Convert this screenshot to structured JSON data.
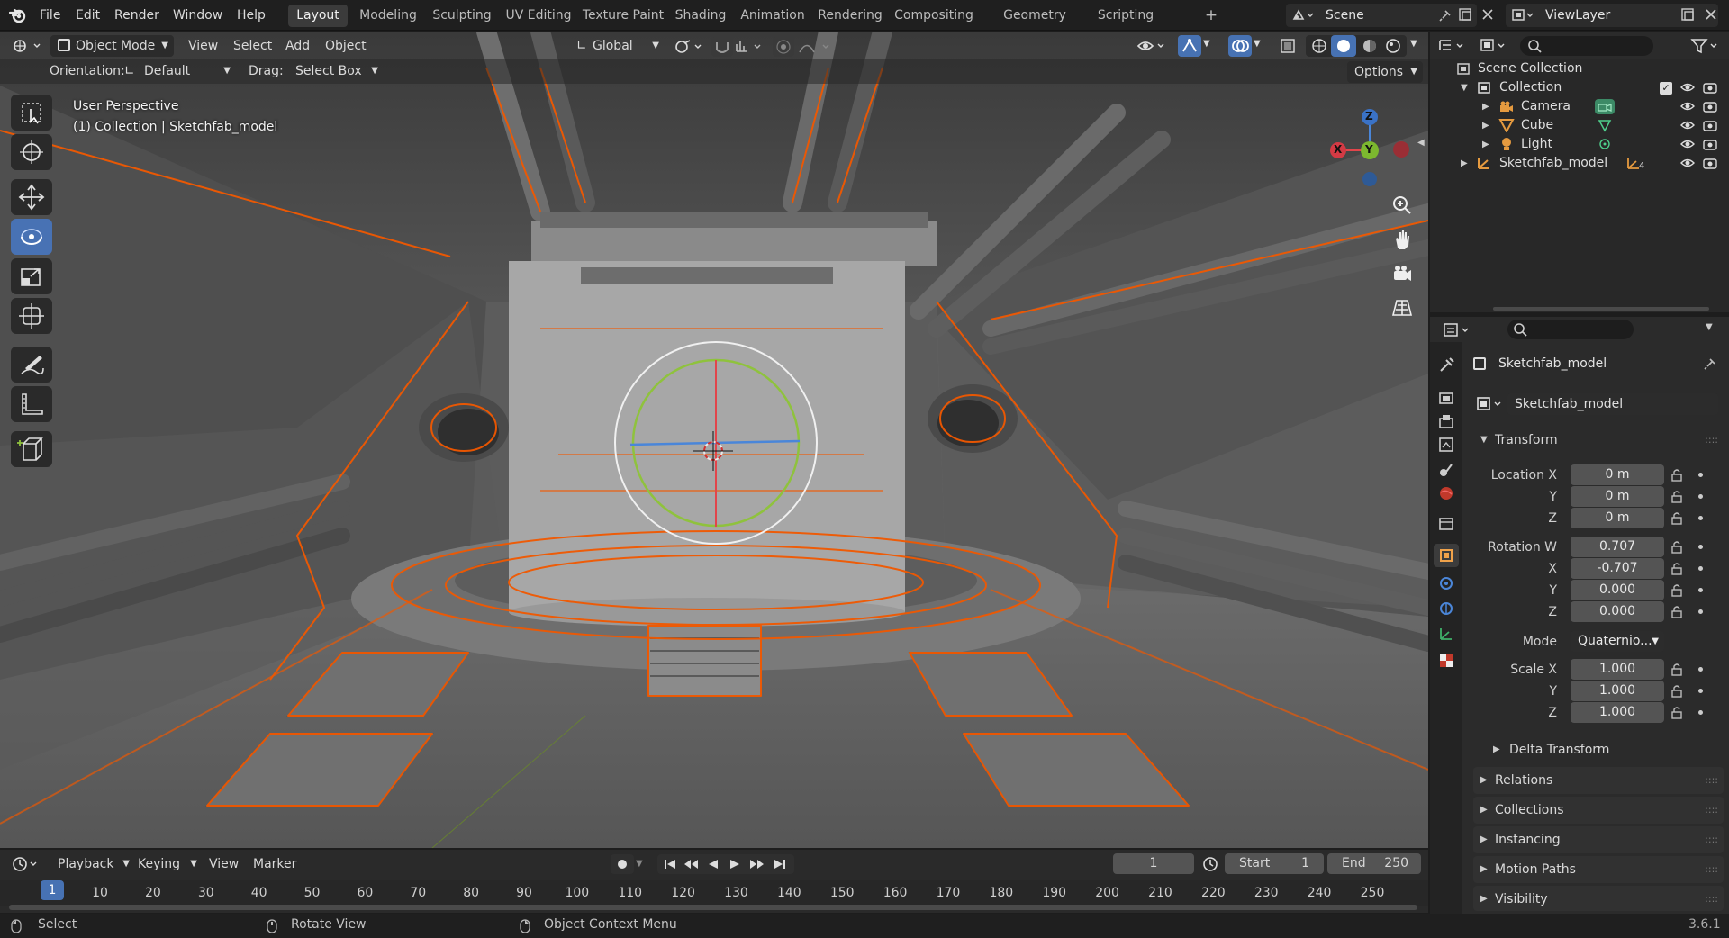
{
  "menu": {
    "file": "File",
    "edit": "Edit",
    "render": "Render",
    "window": "Window",
    "help": "Help"
  },
  "workspaces": [
    "Layout",
    "Modeling",
    "Sculpting",
    "UV Editing",
    "Texture Paint",
    "Shading",
    "Animation",
    "Rendering",
    "Compositing",
    "Geometry Nodes",
    "Scripting"
  ],
  "active_workspace": "Layout",
  "add_workspace": "+",
  "scene": {
    "name": "Scene"
  },
  "view_layer": {
    "name": "ViewLayer"
  },
  "viewport_header": {
    "mode": "Object Mode",
    "view": "View",
    "select": "Select",
    "add": "Add",
    "object": "Object",
    "transform_orientation": "Global"
  },
  "tool_settings": {
    "orientation_label": "Orientation:",
    "orientation_value": "Default",
    "drag_label": "Drag:",
    "drag_value": "Select Box",
    "options": "Options"
  },
  "overlay_text": {
    "line1": "User Perspective",
    "line2": "(1) Collection | Sketchfab_model"
  },
  "gizmo": {
    "x": "X",
    "y": "Y",
    "z": "Z"
  },
  "outliner": {
    "search_placeholder": "",
    "scene_collection": "Scene Collection",
    "collection": "Collection",
    "items": [
      {
        "name": "Camera"
      },
      {
        "name": "Cube"
      },
      {
        "name": "Light"
      }
    ],
    "sketchfab": "Sketchfab_model",
    "sketchfab_children": "4"
  },
  "properties": {
    "object_name": "Sketchfab_model",
    "data_name": "Sketchfab_model",
    "transform_header": "Transform",
    "location_label": "Location X",
    "y_label": "Y",
    "z_label": "Z",
    "x_label": "X",
    "location": {
      "x": "0 m",
      "y": "0 m",
      "z": "0 m"
    },
    "rotation_label": "Rotation W",
    "rotation": {
      "w": "0.707",
      "x": "-0.707",
      "y": "0.000",
      "z": "0.000"
    },
    "mode_label": "Mode",
    "mode_value": "Quaternio...",
    "scale_label": "Scale X",
    "scale": {
      "x": "1.000",
      "y": "1.000",
      "z": "1.000"
    },
    "delta": "Delta Transform",
    "panels": [
      "Relations",
      "Collections",
      "Instancing",
      "Motion Paths",
      "Visibility"
    ]
  },
  "timeline": {
    "playback": "Playback",
    "keying": "Keying",
    "view": "View",
    "marker": "Marker",
    "current_frame": "1",
    "start_label": "Start",
    "start": "1",
    "end_label": "End",
    "end": "250",
    "ticks": [
      "1",
      "10",
      "20",
      "30",
      "40",
      "50",
      "60",
      "70",
      "80",
      "90",
      "100",
      "110",
      "120",
      "130",
      "140",
      "150",
      "160",
      "170",
      "180",
      "190",
      "200",
      "210",
      "220",
      "230",
      "240",
      "250"
    ]
  },
  "status": {
    "select": "Select",
    "rotate": "Rotate View",
    "context": "Object Context Menu",
    "version": "3.6.1"
  },
  "colors": {
    "accent": "#4772b3",
    "selection": "#f15800",
    "bg": "#1d1d1d",
    "panel": "#2b2b2b",
    "viewport": "#5f5f5f"
  }
}
